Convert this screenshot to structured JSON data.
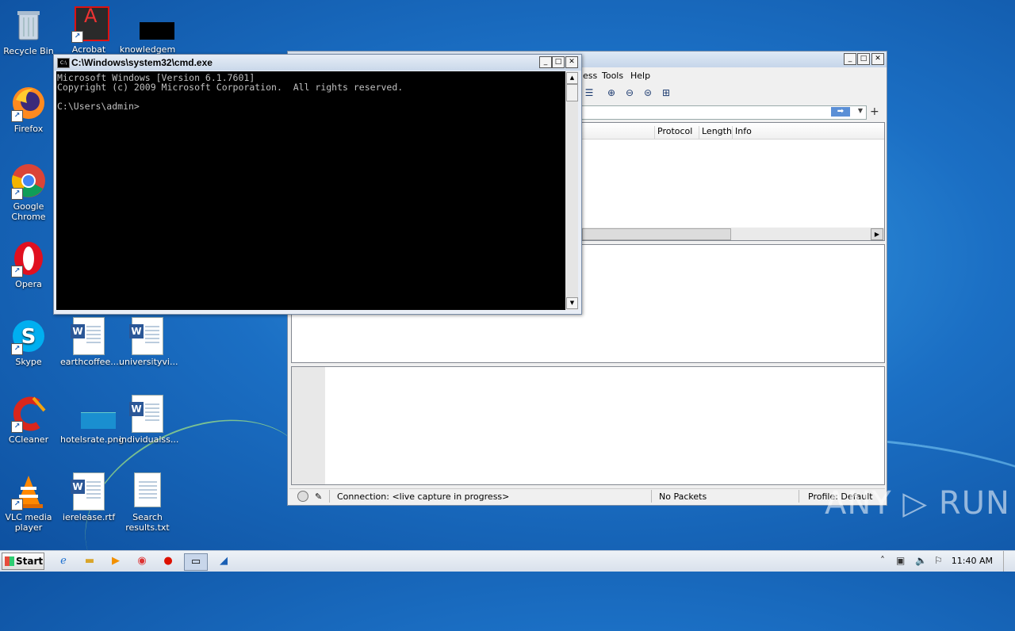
{
  "desktop": {
    "icons": [
      {
        "label": "Recycle Bin",
        "glyph": "🗑"
      },
      {
        "label": "Acrobat",
        "glyph": "A"
      },
      {
        "label": "knowledgem",
        "glyph": ""
      },
      {
        "label": "Firefox",
        "glyph": "🦊"
      },
      {
        "label": "Google Chrome",
        "glyph": "◉"
      },
      {
        "label": "Opera",
        "glyph": "O"
      },
      {
        "label": "Skype",
        "glyph": "S"
      },
      {
        "label": "earthcoffee....",
        "glyph": "W"
      },
      {
        "label": "universityvi...",
        "glyph": "W"
      },
      {
        "label": "CCleaner",
        "glyph": "C"
      },
      {
        "label": "hotelsrate.png",
        "glyph": ""
      },
      {
        "label": "individualss...",
        "glyph": "W"
      },
      {
        "label": "VLC media player",
        "glyph": "▲"
      },
      {
        "label": "ierelease.rtf",
        "glyph": "W"
      },
      {
        "label": "Search results.txt",
        "glyph": ""
      }
    ]
  },
  "wireshark": {
    "menu": [
      "ess",
      "Tools",
      "Help"
    ],
    "columns": [
      "Protocol",
      "Length",
      "Info"
    ],
    "status": {
      "connection": "Connection: <live capture in progress>",
      "packets": "No Packets",
      "profile": "Profile: Default"
    }
  },
  "cmd": {
    "title": "C:\\Windows\\system32\\cmd.exe",
    "icon_text": "C:\\",
    "lines": [
      "Microsoft Windows [Version 6.1.7601]",
      "Copyright (c) 2009 Microsoft Corporation.  All rights reserved.",
      "",
      "C:\\Users\\admin>"
    ]
  },
  "taskbar": {
    "start_label": "Start",
    "clock": "11:40 AM"
  },
  "watermark": "ANY ▷ RUN",
  "colors": {
    "desktop_bg": "#1b6fc4",
    "console_bg": "#000000",
    "console_fg": "#c0c0c0",
    "filter_arrow": "#5a8fd6"
  }
}
